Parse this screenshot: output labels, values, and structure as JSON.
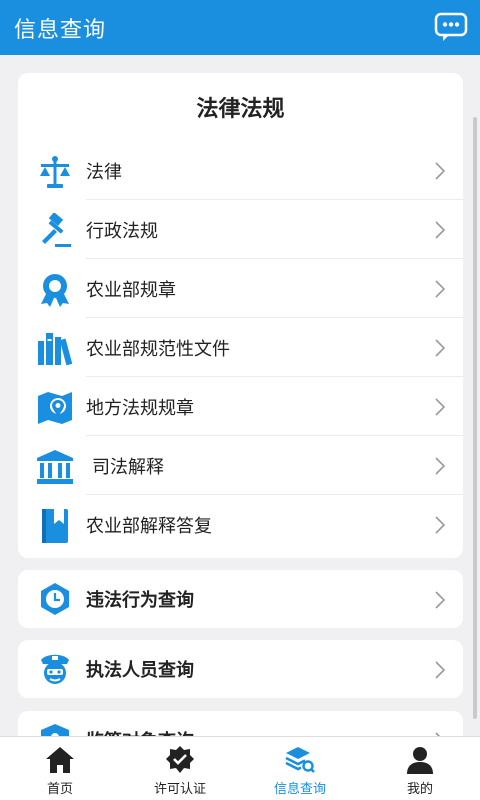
{
  "header": {
    "title": "信息查询",
    "chat_icon": "chat-bubble-icon"
  },
  "colors": {
    "brand": "#1a8fe0",
    "background": "#f0f0f2"
  },
  "laws_card": {
    "title": "法律法规",
    "items": [
      {
        "label": "法律",
        "icon": "scales-icon"
      },
      {
        "label": "行政法规",
        "icon": "gavel-icon"
      },
      {
        "label": "农业部规章",
        "icon": "award-badge-icon"
      },
      {
        "label": "农业部规范性文件",
        "icon": "books-icon"
      },
      {
        "label": "地方法规规章",
        "icon": "map-pin-icon"
      },
      {
        "label": "司法解释",
        "icon": "courthouse-icon"
      },
      {
        "label": "农业部解释答复",
        "icon": "bookmark-book-icon"
      }
    ]
  },
  "violation_card": {
    "label": "违法行为查询",
    "icon": "clock-hexagon-icon"
  },
  "officer_card": {
    "label": "执法人员查询",
    "icon": "officer-icon"
  },
  "supervision_card": {
    "label": "监管对象查询",
    "icon": "person-shield-icon"
  },
  "tabbar": {
    "tabs": [
      {
        "label": "首页",
        "icon": "home-icon",
        "active": false
      },
      {
        "label": "许可认证",
        "icon": "badge-check-icon",
        "active": false
      },
      {
        "label": "信息查询",
        "icon": "layers-search-icon",
        "active": true
      },
      {
        "label": "我的",
        "icon": "user-icon",
        "active": false
      }
    ]
  }
}
